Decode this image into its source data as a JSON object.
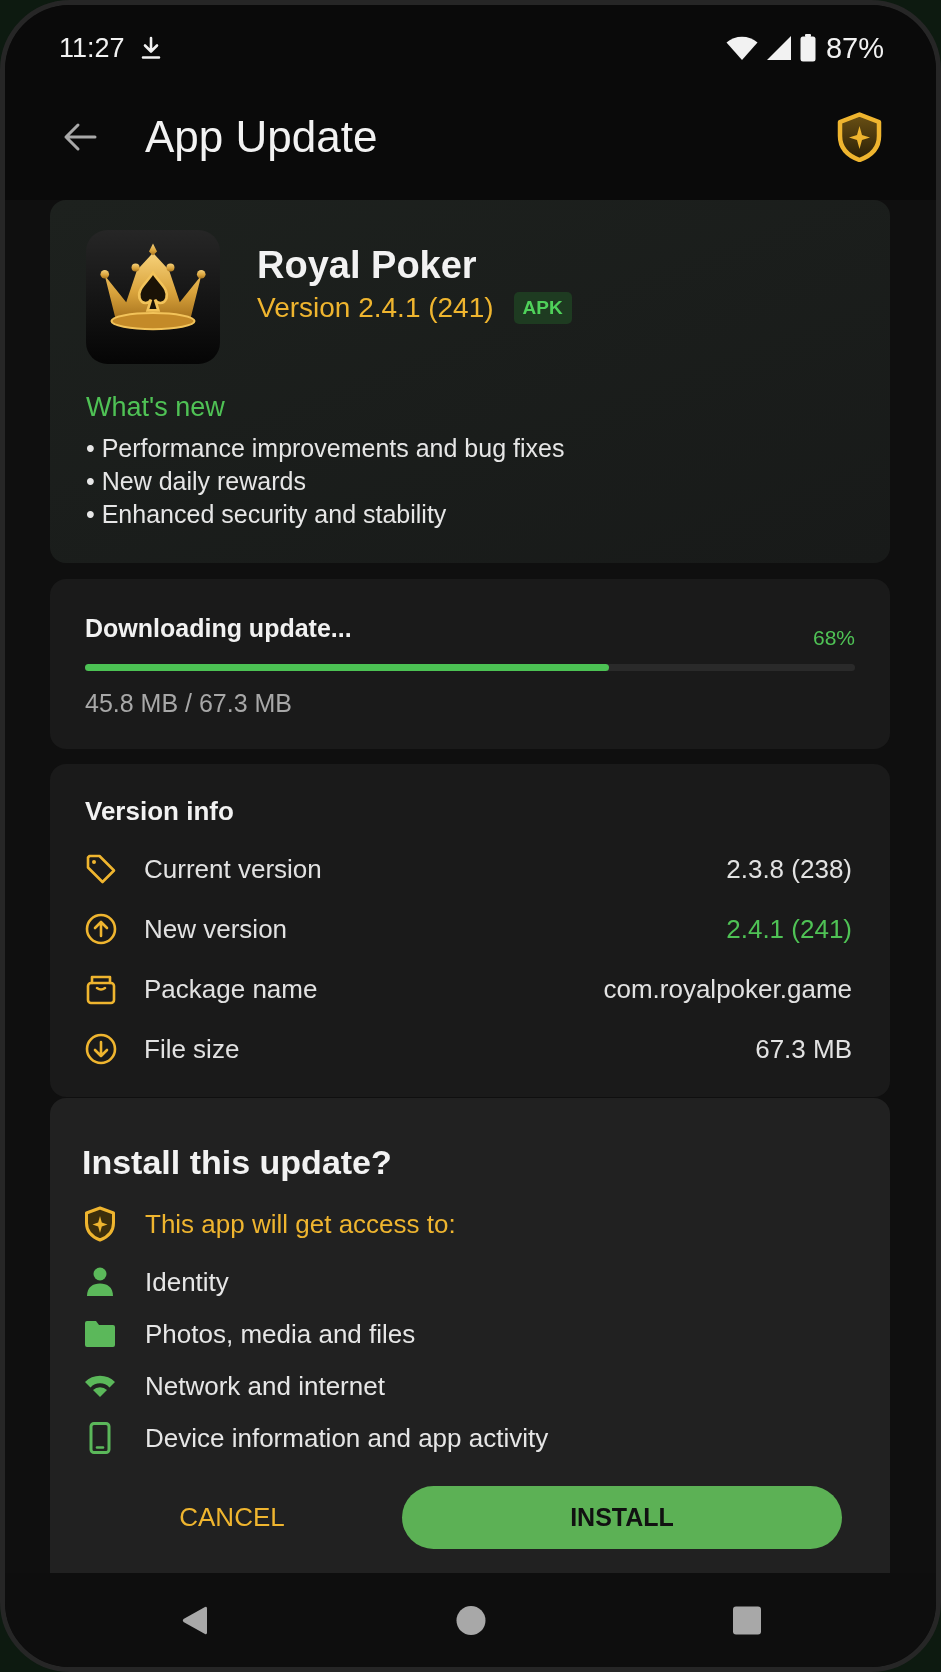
{
  "status_bar": {
    "time": "11:27",
    "battery": "87%"
  },
  "header": {
    "title": "App Update"
  },
  "app": {
    "name": "Royal Poker",
    "version": "Version 2.4.1 (241)",
    "badge": "APK",
    "whats_new": {
      "title": "What's new",
      "items": [
        "• Performance improvements and bug fixes",
        "• New daily rewards",
        "• Enhanced security and stability"
      ]
    }
  },
  "download": {
    "title": "Downloading update...",
    "percent": "68%",
    "level": 0.68,
    "size": "45.8 MB / 67.3 MB"
  },
  "version_info": {
    "title": "Version info",
    "rows": [
      {
        "kind": "tag",
        "label": "Current version",
        "value": "2.3.8 (238)",
        "highlighted": false
      },
      {
        "kind": "upgrade",
        "label": "New version",
        "value": "2.4.1 (241)",
        "highlighted": true
      },
      {
        "kind": "package",
        "label": "Package name",
        "value": "com.royalpoker.game",
        "highlighted": false
      },
      {
        "kind": "size",
        "label": "File size",
        "value": "67.3 MB",
        "highlighted": false
      }
    ]
  },
  "install": {
    "title": "Install this update?",
    "notice": "This app will get access to:",
    "permissions": [
      {
        "kind": "identity",
        "label": "Identity"
      },
      {
        "kind": "storage",
        "label": "Photos, media and files"
      },
      {
        "kind": "network",
        "label": "Network and internet"
      },
      {
        "kind": "device",
        "label": "Device information and app activity"
      }
    ],
    "buttons": [
      {
        "kind": "text",
        "label": "CANCEL"
      },
      {
        "kind": "filled",
        "label": "INSTALL"
      }
    ]
  }
}
